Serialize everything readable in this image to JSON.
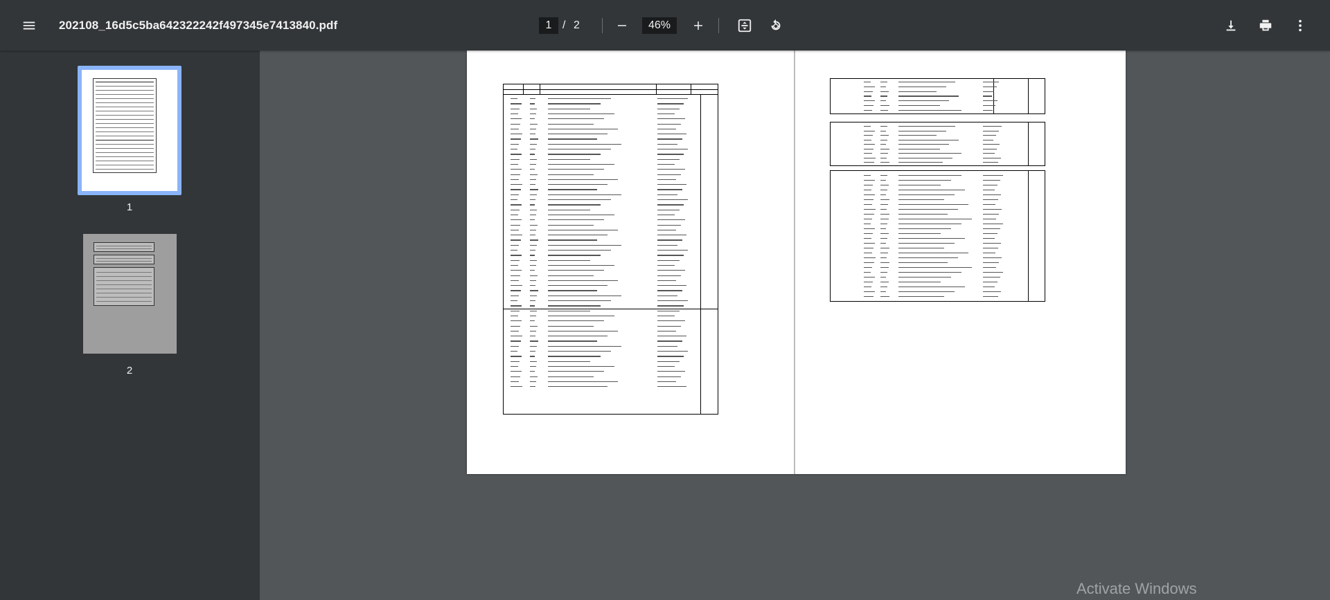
{
  "toolbar": {
    "title": "202108_16d5c5ba642322242f497345e7413840.pdf",
    "current_page": "1",
    "page_separator": "/",
    "total_pages": "2",
    "zoom": "46%",
    "icons": [
      "menu-icon",
      "zoom-out-icon",
      "zoom-in-icon",
      "fit-to-page-icon",
      "rotate-icon",
      "download-icon",
      "print-icon",
      "more-vert-icon"
    ]
  },
  "sidebar": {
    "thumbnails": [
      {
        "label": "1",
        "selected": true
      },
      {
        "label": "2",
        "selected": false
      }
    ]
  },
  "document": {
    "page1_header": [
      "Код",
      "Шинж",
      "Дансны нэр",
      "Холбох"
    ],
    "page1_section": "ХӨРӨНГӨ",
    "page2_sections": [
      "5. Эздийн өмч",
      "6. Орлогын данс",
      "7. Зардлын данс"
    ]
  },
  "os_watermark": "Activate Windows",
  "colors": {
    "toolbar_bg": "#323639",
    "viewer_bg": "#525659",
    "accent": "#8ab4f8"
  }
}
